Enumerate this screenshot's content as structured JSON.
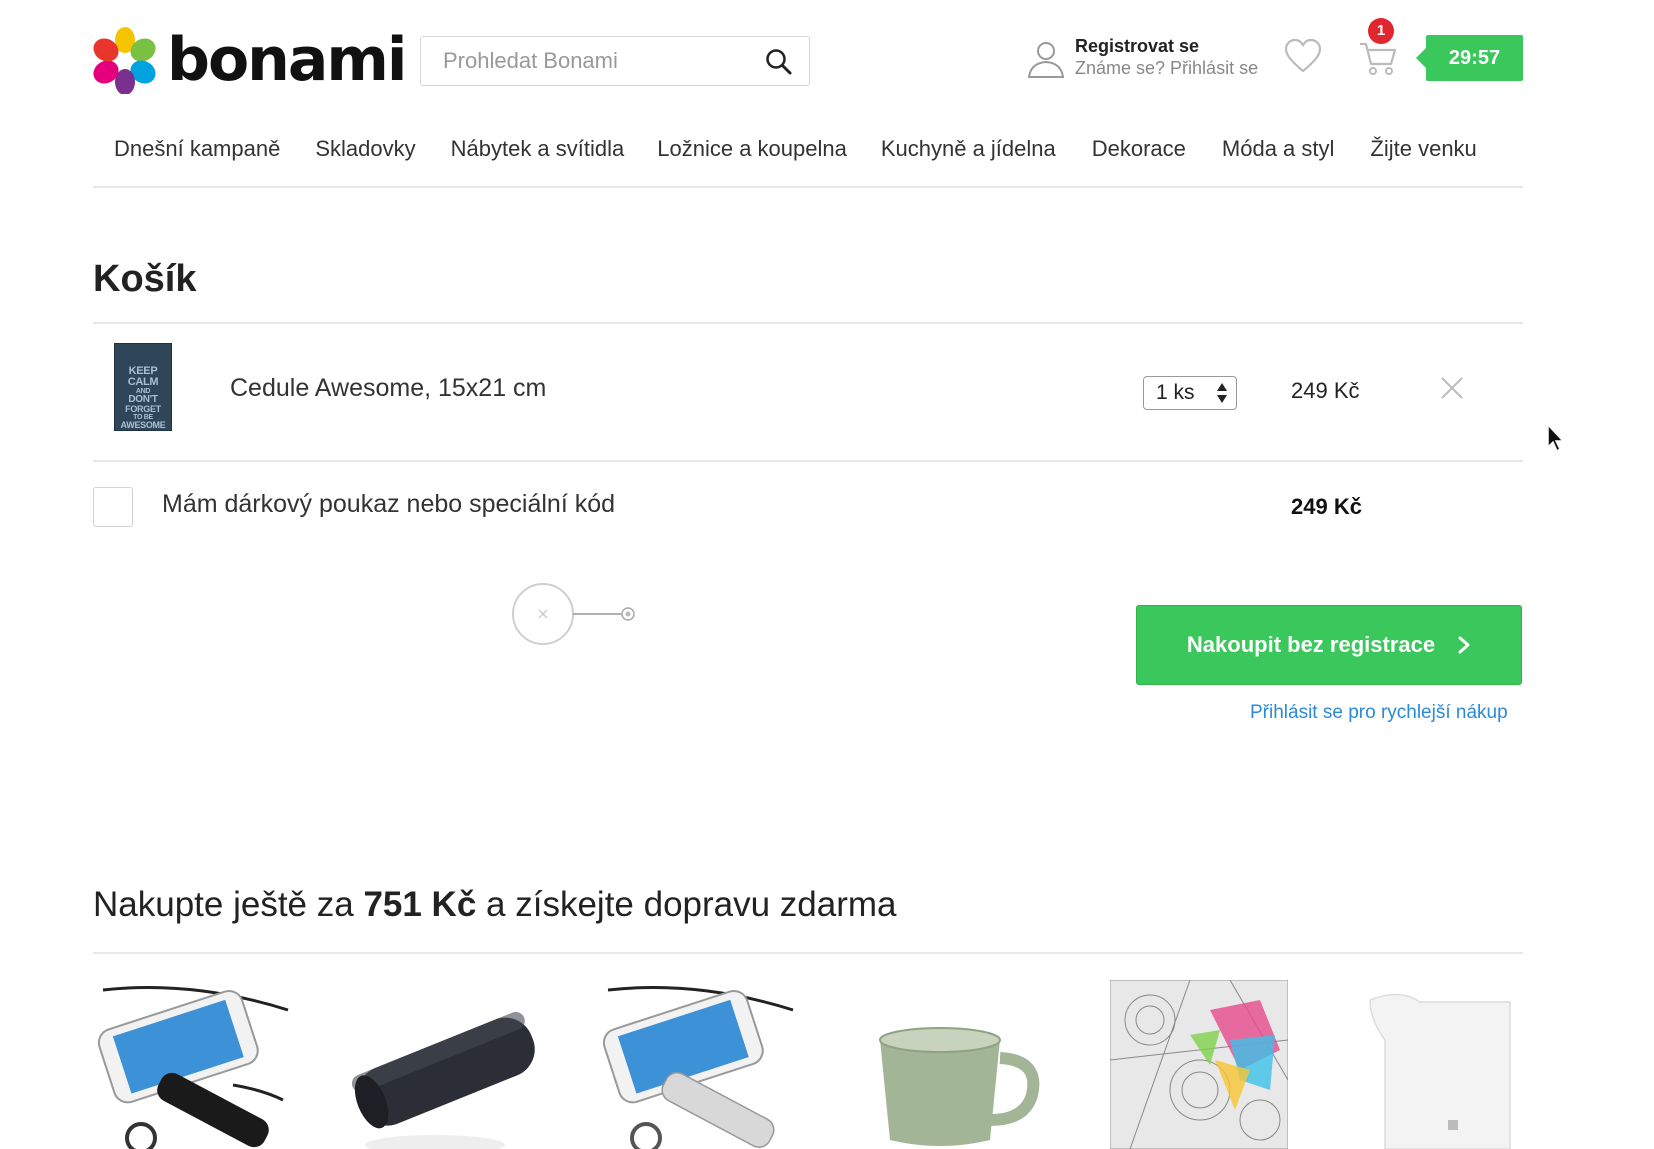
{
  "header": {
    "logo_text": "bonami",
    "search_placeholder": "Prohledat Bonami",
    "register_label": "Registrovat se",
    "login_prompt": "Známe se? Přihlásit se",
    "cart_count": "1",
    "timer": "29:57"
  },
  "nav": {
    "items": [
      "Dnešní kampaně",
      "Skladovky",
      "Nábytek a svítidla",
      "Ložnice a koupelna",
      "Kuchyně a jídelna",
      "Dekorace",
      "Móda a styl",
      "Žijte venku"
    ]
  },
  "cart": {
    "title": "Košík",
    "item": {
      "name": "Cedule Awesome, 15x21 cm",
      "quantity": "1 ks",
      "price": "249 Kč",
      "thumb_lines": [
        "KEEP",
        "CALM",
        "AND",
        "DON'T",
        "FORGET",
        "TO BE",
        "AWESOME"
      ]
    },
    "voucher_label": "Mám dárkový poukaz nebo speciální kód",
    "total": "249 Kč",
    "buy_button": "Nakoupit bez registrace",
    "login_link": "Přihlásit se pro rychlejší nákup"
  },
  "promo": {
    "prefix": "Nakupte ještě za ",
    "amount": "751 Kč",
    "suffix": " a získejte dopravu zdarma"
  },
  "colors": {
    "accent_green": "#3ac75b",
    "link_blue": "#2a8ad8",
    "badge_red": "#e0262e"
  }
}
